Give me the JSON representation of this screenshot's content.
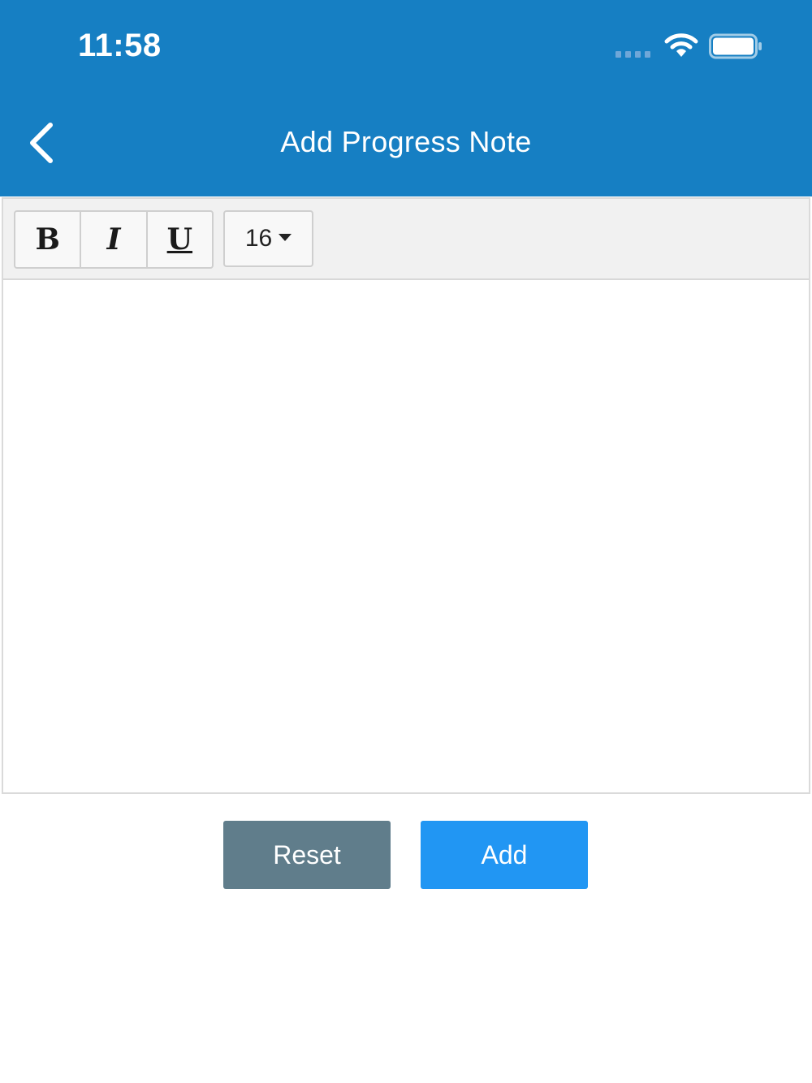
{
  "status_bar": {
    "time": "11:58"
  },
  "nav": {
    "title": "Add Progress Note",
    "back_icon": "chevron-left-icon"
  },
  "toolbar": {
    "bold_label": "B",
    "italic_label": "I",
    "underline_label": "U",
    "font_size": "16"
  },
  "editor": {
    "content": ""
  },
  "actions": {
    "reset_label": "Reset",
    "add_label": "Add"
  },
  "colors": {
    "header": "#167fc3",
    "reset_button": "#607d8b",
    "add_button": "#2196f3"
  }
}
